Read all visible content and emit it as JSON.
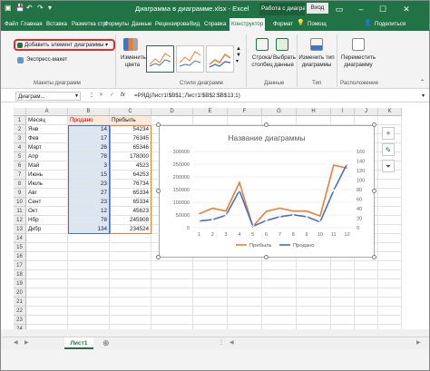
{
  "window": {
    "title": "Диаграмма в диаграмме.xlsx - Excel",
    "context_tab": "Работа с диаграммами",
    "login_button": "Вход"
  },
  "tabs": [
    "Файл",
    "Главная",
    "Вставка",
    "Разметка стр",
    "Формулы",
    "Данные",
    "Рецензирова",
    "Вид",
    "Справка",
    "Конструктор",
    "Формат",
    "Помощ"
  ],
  "share_label": "Поделиться",
  "ribbon": {
    "add_element": "Добавить элемент диаграммы",
    "quick_layout": "Экспресс-макет",
    "group_layouts": "Макеты диаграмм",
    "change_colors": "Изменить цвета",
    "group_styles": "Стили диаграмм",
    "row_col": "Строка/ столбец",
    "select_data": "Выбрать данные",
    "group_data": "Данные",
    "change_type": "Изменить тип диаграммы",
    "group_type": "Тип",
    "move_chart": "Переместить диаграмму",
    "group_location": "Расположение"
  },
  "formula_bar": {
    "name_box": "Диаграм...",
    "formula": "=РЯД(Лист1!$B$1;;Лист1!$B$2:$B$13;1)"
  },
  "columns": [
    "A",
    "B",
    "C",
    "D",
    "E",
    "F",
    "G",
    "H",
    "I",
    "J",
    "K"
  ],
  "rows": [
    "1",
    "2",
    "3",
    "4",
    "5",
    "6",
    "7",
    "8",
    "9",
    "10",
    "11",
    "12",
    "13",
    "14",
    "15",
    "16",
    "17",
    "18",
    "19",
    "20",
    "21",
    "22",
    "23",
    "24"
  ],
  "table": {
    "headers": [
      "Месяц",
      "Продано",
      "Прибыль"
    ],
    "data": [
      [
        "Янв",
        "14",
        "54234"
      ],
      [
        "Фев",
        "17",
        "76345"
      ],
      [
        "Март",
        "26",
        "65346"
      ],
      [
        "Апр",
        "78",
        "178000"
      ],
      [
        "Май",
        "3",
        "4523"
      ],
      [
        "Июнь",
        "15",
        "64253"
      ],
      [
        "Июль",
        "23",
        "76734"
      ],
      [
        "Авг",
        "27",
        "65334"
      ],
      [
        "Сент",
        "23",
        "65334"
      ],
      [
        "Окт",
        "12",
        "45623"
      ],
      [
        "Нбр",
        "78",
        "245908"
      ],
      [
        "Дкбр",
        "134",
        "234524"
      ]
    ]
  },
  "chart_data": {
    "type": "line",
    "title": "Название диаграммы",
    "categories": [
      "1",
      "2",
      "3",
      "4",
      "5",
      "6",
      "7",
      "8",
      "9",
      "10",
      "11",
      "12"
    ],
    "y_left": {
      "ticks": [
        "0",
        "50000",
        "100000",
        "150000",
        "200000",
        "250000",
        "300000"
      ],
      "lim": [
        0,
        300000
      ]
    },
    "y_right": {
      "ticks": [
        "0",
        "20",
        "40",
        "60",
        "80",
        "100",
        "120",
        "140",
        "160"
      ],
      "lim": [
        0,
        160
      ]
    },
    "series": [
      {
        "name": "Прибыль",
        "axis": "left",
        "color": "#ed7d31",
        "values": [
          54234,
          76345,
          65346,
          178000,
          4523,
          64253,
          76734,
          65334,
          65334,
          45623,
          245908,
          234524
        ]
      },
      {
        "name": "Продано",
        "axis": "right",
        "color": "#4472c4",
        "values": [
          14,
          17,
          26,
          78,
          3,
          15,
          23,
          27,
          23,
          12,
          78,
          134
        ]
      }
    ],
    "legend_position": "bottom"
  },
  "sheet_tab": "Лист1",
  "colors": {
    "excel_green": "#217346",
    "highlight_red": "#d9302c"
  }
}
